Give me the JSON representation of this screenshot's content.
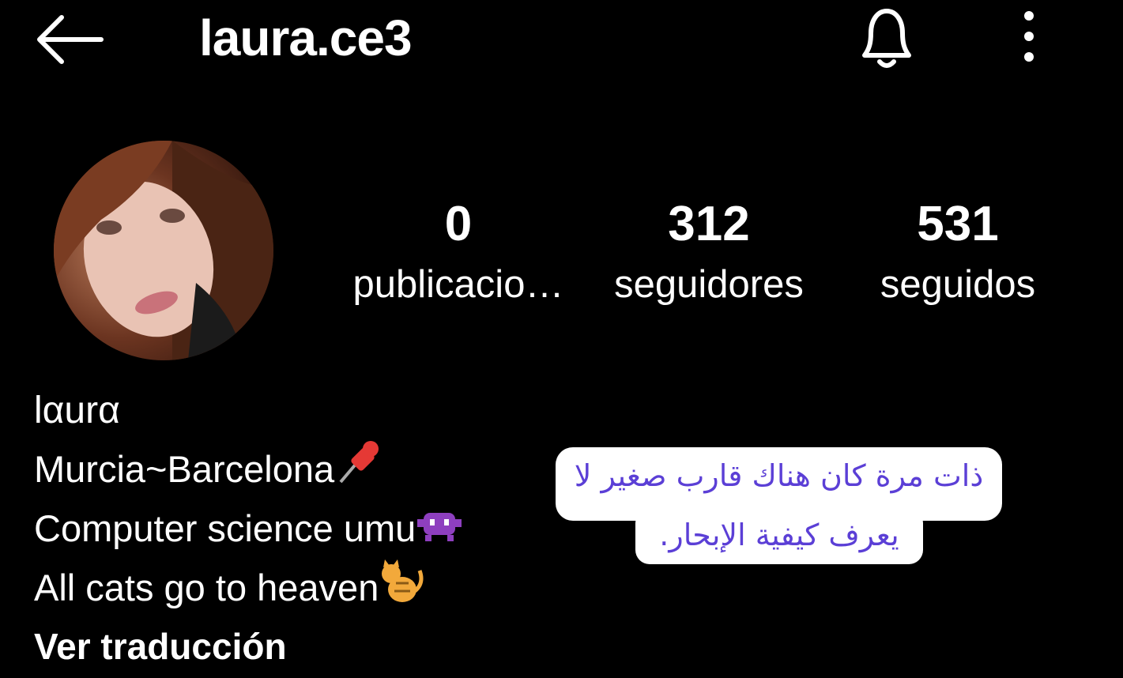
{
  "header": {
    "username": "laura.ce3",
    "back_icon": "arrow-left-icon",
    "bell_icon": "bell-icon",
    "more_icon": "more-vertical-icon"
  },
  "stats": [
    {
      "value": "0",
      "label": "publicacio…"
    },
    {
      "value": "312",
      "label": "seguidores"
    },
    {
      "value": "531",
      "label": "seguidos"
    }
  ],
  "bio": {
    "name": "lαurα",
    "line1": "Murcia~Barcelona",
    "line1_emoji": "pushpin-icon",
    "line2": "Computer science umu",
    "line2_emoji": "alien-monster-icon",
    "line3": "All cats go to heaven",
    "line3_emoji": "cat-icon",
    "translate": "Ver traducción"
  },
  "overlay": {
    "line1": "ذات مرة كان هناك قارب صغير لا",
    "line2": "يعرف كيفية الإبحار."
  },
  "colors": {
    "background": "#000000",
    "text": "#ffffff",
    "overlay_text": "#5b3fd6"
  }
}
